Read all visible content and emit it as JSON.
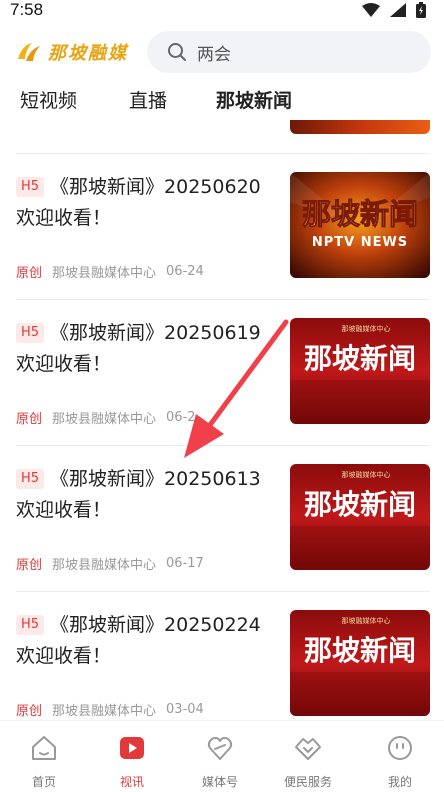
{
  "status_bar": {
    "time": "7:58",
    "icons": [
      "wifi-icon",
      "signal-icon",
      "battery-icon"
    ]
  },
  "header": {
    "logo_text": "那坡融媒",
    "search_placeholder": "两会"
  },
  "tabs": [
    {
      "label": "短视频",
      "active": false
    },
    {
      "label": "直播",
      "active": false
    },
    {
      "label": "那坡新闻",
      "active": true
    }
  ],
  "articles": [
    {
      "badge": "H5",
      "title": "《那坡新闻》20250620欢迎收看！",
      "tag": "原创",
      "source": "那坡县融媒体中心",
      "date": "06-24",
      "thumb_main": "那坡新闻",
      "thumb_sub": "NPTV NEWS",
      "thumb_style": "gold"
    },
    {
      "badge": "H5",
      "title": "《那坡新闻》20250619欢迎收看！",
      "tag": "原创",
      "source": "那坡县融媒体中心",
      "date": "06-2",
      "thumb_main": "那坡新闻",
      "thumb_top": "那坡融媒体中心",
      "thumb_style": "red"
    },
    {
      "badge": "H5",
      "title": "《那坡新闻》20250613欢迎收看！",
      "tag": "原创",
      "source": "那坡县融媒体中心",
      "date": "06-17",
      "thumb_main": "那坡新闻",
      "thumb_top": "那坡融媒体中心",
      "thumb_style": "red"
    },
    {
      "badge": "H5",
      "title": "《那坡新闻》20250224 欢迎收看！",
      "tag": "原创",
      "source": "那坡县融媒体中心",
      "date": "03-04",
      "thumb_main": "那坡新闻",
      "thumb_top": "那坡融媒体中心",
      "thumb_style": "red"
    }
  ],
  "bottom_nav": [
    {
      "label": "首页",
      "icon": "home-icon",
      "active": false
    },
    {
      "label": "视讯",
      "icon": "video-play-icon",
      "active": true
    },
    {
      "label": "媒体号",
      "icon": "media-account-icon",
      "active": false
    },
    {
      "label": "便民服务",
      "icon": "handshake-icon",
      "active": false
    },
    {
      "label": "我的",
      "icon": "profile-face-icon",
      "active": false
    }
  ],
  "colors": {
    "accent": "#e2393b",
    "logo": "#e7a412",
    "arrow": "#f0404a"
  }
}
